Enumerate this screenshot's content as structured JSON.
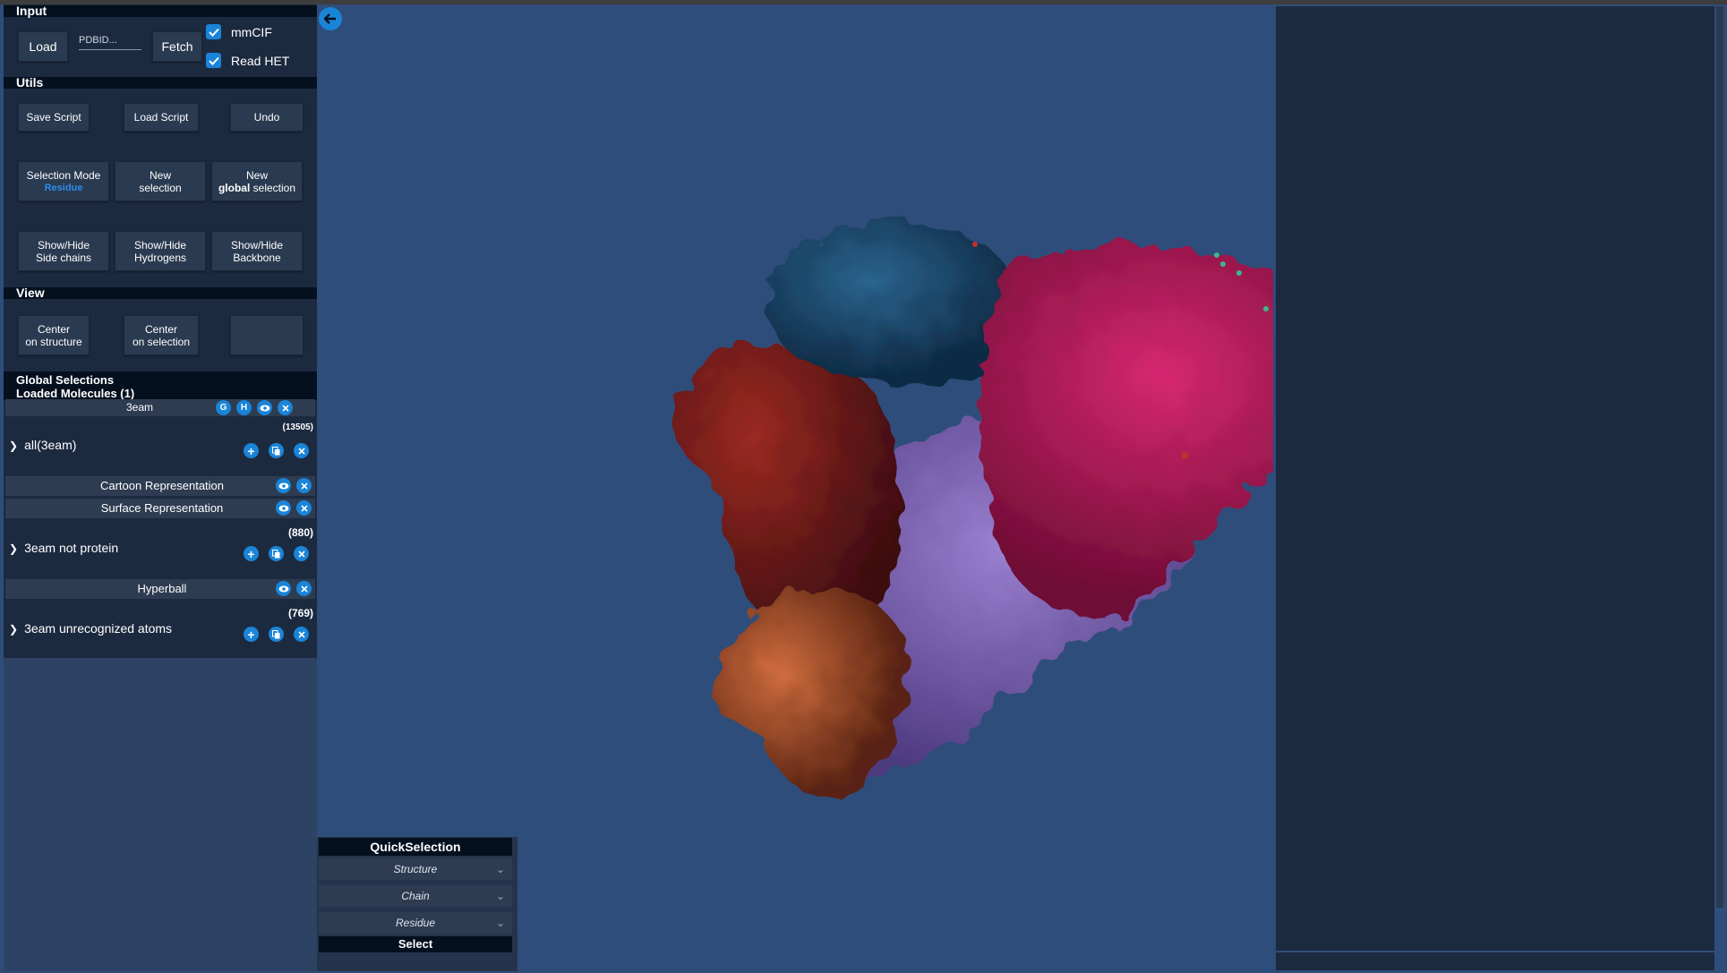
{
  "input": {
    "header": "Input",
    "load_label": "Load",
    "pdbid_placeholder": "PDBID...",
    "fetch_label": "Fetch",
    "mmcif_label": "mmCIF",
    "mmcif_checked": true,
    "readhet_label": "Read HET",
    "readhet_checked": true
  },
  "utils": {
    "header": "Utils",
    "save_script": "Save Script",
    "load_script": "Load Script",
    "undo": "Undo",
    "selection_mode_line1": "Selection Mode",
    "selection_mode_value": "Residue",
    "new_selection_line1": "New",
    "new_selection_line2": "selection",
    "new_global_line1": "New",
    "new_global_bold": "global",
    "new_global_rest": " selection",
    "sidechains_line1": "Show/Hide",
    "sidechains_line2": "Side chains",
    "hydrogens_line1": "Show/Hide",
    "hydrogens_line2": "Hydrogens",
    "backbone_line1": "Show/Hide",
    "backbone_line2": "Backbone"
  },
  "view": {
    "header": "View",
    "center_structure_line1": "Center",
    "center_structure_line2": "on structure",
    "center_selection_line1": "Center",
    "center_selection_line2": "on selection"
  },
  "global_selections": {
    "header": "Global Selections",
    "loaded_header": "Loaded Molecules (1)",
    "molecule_name": "3eam",
    "molecule_g": "G",
    "molecule_h": "H",
    "selections": [
      {
        "count": "(13505)",
        "label": "all(3eam)"
      },
      {
        "count": "(880)",
        "label": "3eam not protein"
      },
      {
        "count": "(769)",
        "label": "3eam unrecognized atoms"
      }
    ],
    "representations": [
      "Cartoon Representation",
      "Surface Representation",
      "Hyperball"
    ]
  },
  "quick_selection": {
    "title": "QuickSelection",
    "structure": "Structure",
    "chain": "Chain",
    "residue": "Residue",
    "select": "Select"
  },
  "colors": {
    "background": "#2f4d7a",
    "panel": "#1c2a40",
    "header": "#05101f",
    "accent": "#1a84d8",
    "chain_magenta": "#b8175a",
    "chain_blue": "#1e4f78",
    "chain_red": "#7a1e1e",
    "chain_purple": "#7f62b8",
    "chain_orange": "#b35a34"
  }
}
